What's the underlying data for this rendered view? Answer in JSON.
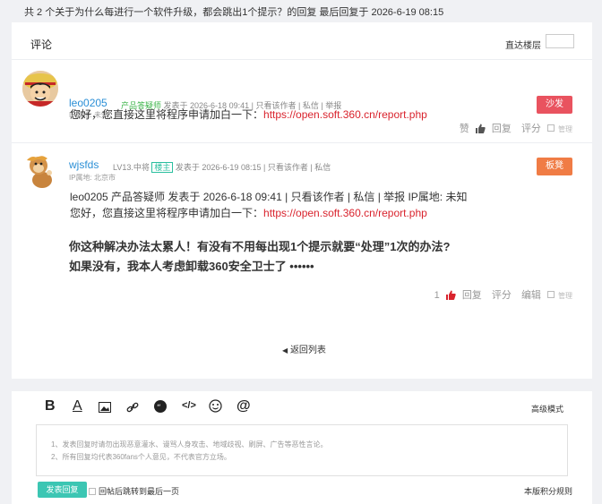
{
  "topbar": {
    "summary": "共 2 个关于为什么每进行一个软件升级，都会跳出1个提示？的回复 最后回复于 2026-6-19 08:15"
  },
  "comments": {
    "title": "评论",
    "jump_label": "直达楼层"
  },
  "posts": [
    {
      "username": "leo0205",
      "role": "产品答疑师",
      "posted": "发表于 2026-6-18 09:41",
      "view_author": "只看该作者",
      "message": "私信",
      "report": "举报",
      "ip": "IP属地: 未知",
      "badge": "沙发",
      "badge_color": "#e9535f",
      "text_prefix": "您好，您直接这里将程序申请加白一下：",
      "link": "https://open.soft.360.cn/report.php",
      "actions": {
        "like": "赞",
        "reply": "回复",
        "rate": "评分",
        "manage": "管理"
      }
    },
    {
      "username": "wjsfds",
      "level": "LV13.中将",
      "host_tag": "楼主",
      "posted": "发表于 2026-6-19 08:15",
      "view_author": "只看该作者",
      "message": "私信",
      "ip": "IP属地: 北京市",
      "badge": "板凳",
      "badge_color": "#f07c45",
      "quote_line": "leo0205 产品答疑师 发表于 2026-6-18 09:41 | 只看该作者 | 私信 | 举报  IP属地: 未知",
      "text_prefix": "您好，您直接这里将程序申请加白一下：",
      "link": "https://open.soft.360.cn/report.php",
      "bold_line1": "你这种解决办法太累人！有没有不用每出现1个提示就要“处理”1次的办法?",
      "bold_line2": "如果没有，我本人考虑卸载360安全卫士了 ••••••",
      "actions": {
        "like_count": "1",
        "reply": "回复",
        "rate": "评分",
        "edit": "编辑",
        "manage": "管理"
      }
    }
  ],
  "back_link": "返回列表",
  "editor": {
    "advanced": "高级模式",
    "notice1": "1、发表回复时请勿出现恶意灌水、谩骂人身攻击、地域歧视、刷屏、广告等恶性言论。",
    "notice2": "2、所有回复均代表360fans个人意见，不代表官方立场。",
    "submit": "发表回复",
    "after_post": "回帖后跳转到最后一页",
    "rules": "本版积分规则"
  },
  "colors": {
    "link": "#d9232d",
    "username": "#2b8fd6",
    "accent": "#3cc6b3"
  }
}
